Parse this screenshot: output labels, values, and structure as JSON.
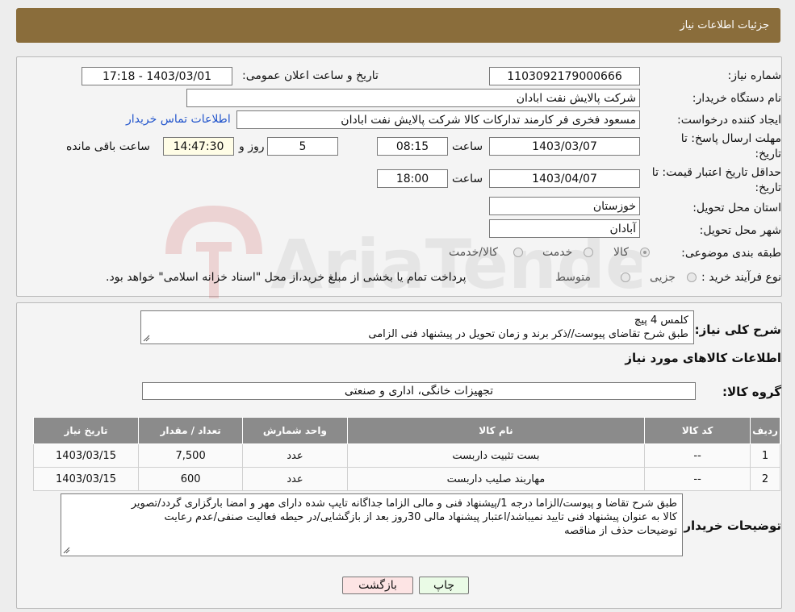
{
  "header": {
    "title": "جزئیات اطلاعات نیاز"
  },
  "form": {
    "need_no_label": "شماره نیاز:",
    "need_no": "1103092179000666",
    "announce_label": "تاریخ و ساعت اعلان عمومی:",
    "announce_value": "1403/03/01 - 17:18",
    "buyer_label": "نام دستگاه خریدار:",
    "buyer": "شرکت پالایش نفت ابادان",
    "creator_label": "ایجاد کننده درخواست:",
    "creator": "مسعود فخری فر کارمند تدارکات کالا شرکت پالایش نفت ابادان",
    "contact_link": "اطلاعات تماس خریدار",
    "deadline_label_1": "مهلت ارسال پاسخ: تا",
    "deadline_label_2": "تاریخ:",
    "deadline_date": "1403/03/07",
    "time_label": "ساعت",
    "deadline_time": "08:15",
    "days_value": "5",
    "days_label": "روز و",
    "remaining_time": "14:47:30",
    "remaining_label": "ساعت باقی مانده",
    "validity_label_1": "حداقل تاریخ اعتبار قیمت: تا",
    "validity_label_2": "تاریخ:",
    "validity_date": "1403/04/07",
    "validity_time": "18:00",
    "province_label": "استان محل تحویل:",
    "province": "خوزستان",
    "city_label": "شهر محل تحویل:",
    "city": "آبادان",
    "category_label": "طبقه بندی موضوعی:",
    "category_options": [
      "کالا",
      "خدمت",
      "کالا/خدمت"
    ],
    "purchase_label": "نوع فرآیند خرید :",
    "purchase_options": [
      "جزیی",
      "متوسط"
    ],
    "purchase_note": "پرداخت تمام یا بخشی از مبلغ خرید،از محل \"اسناد خزانه اسلامی\" خواهد بود."
  },
  "summary": {
    "label": "شرح کلی نیاز:",
    "line1": "کلمس 4 پیچ",
    "line2": "طبق شرح تقاضای پیوست//ذکر برند و زمان تحویل در پیشنهاد فنی الزامی",
    "items_heading": "اطلاعات کالاهای مورد نیاز",
    "group_label": "گروه کالا:",
    "group_value": "تجهیزات خانگی، اداری و صنعتی"
  },
  "table": {
    "headers": [
      "ردیف",
      "کد کالا",
      "نام کالا",
      "واحد شمارش",
      "تعداد / مقدار",
      "تاریخ نیاز"
    ],
    "rows": [
      [
        "1",
        "--",
        "بست تثبیت داربست",
        "عدد",
        "7,500",
        "1403/03/15"
      ],
      [
        "2",
        "--",
        "مهاربند صلیب داربست",
        "عدد",
        "600",
        "1403/03/15"
      ]
    ]
  },
  "notes": {
    "label": "توضیحات خریدار:",
    "line1": "طبق شرح تقاضا و پیوست/الزاما درجه 1/پیشنهاد فنی و مالی الزاما جداگانه تایپ شده دارای مهر و امضا بارگزاری گردد/تصویر",
    "line2": "کالا به عنوان پیشنهاد فنی تایید نمیباشد/اعتبار پیشنهاد مالی 30روز بعد از بازگشایی/در حیطه فعالیت صنفی/عدم رعایت",
    "line3": "توضیحات حذف از مناقصه"
  },
  "buttons": {
    "print": "چاپ",
    "back": "بازگشت"
  },
  "colors": {
    "header": "#8a6d3b",
    "table_header": "#8b8b8b",
    "print_btn": "#eafbe6",
    "back_btn": "#fde4e4",
    "link": "#2255cc"
  },
  "watermark": "AriaTender.neT"
}
